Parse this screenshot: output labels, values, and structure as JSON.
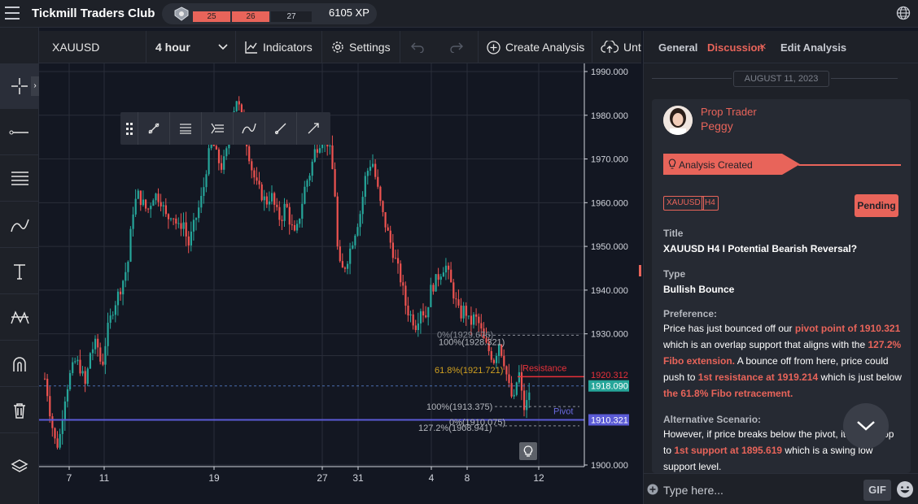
{
  "app": {
    "title": "Tickmill Traders Club"
  },
  "xp": {
    "seg1": "25",
    "seg2": "26",
    "seg3": "27",
    "value": "6105 XP"
  },
  "toolbar": {
    "symbol": "XAUUSD",
    "timeframe": "4 hour",
    "indicators": "Indicators",
    "settings": "Settings",
    "create_analysis": "Create Analysis",
    "upload": "Unt"
  },
  "chart": {
    "prices": [
      "1990.000",
      "1980.000",
      "1970.000",
      "1960.000",
      "1950.000",
      "1940.000",
      "1930.000",
      "1918.090",
      "1910.321",
      "1900.000"
    ],
    "price_under": "1920.312",
    "dates": [
      "7",
      "11",
      "19",
      "27",
      "31",
      "4",
      "8",
      "12"
    ],
    "fib_labels": {
      "top": "0%(1929.676)",
      "top2": "100%(1928.321)",
      "mid": "61.8%(1921.721)",
      "resistance": "Resistance",
      "p100": "100%(1913.375)",
      "pivot": "Pivot",
      "p0": "0%(1910.075)",
      "p127": "127.2%(1908.941)"
    },
    "colors": {
      "up": "#26a69a",
      "down": "#ef5350",
      "pivot": "#5b5bd6",
      "resistance": "#e8313a"
    }
  },
  "panel": {
    "tabs": [
      "General",
      "Discussion",
      "Edit Analysis"
    ],
    "tab_close": "×",
    "date": "AUGUST 11, 2023",
    "author_role": "Prop Trader",
    "author_name": "Peggy",
    "event": "Analysis Created",
    "tags": [
      "XAUUSD",
      "H4"
    ],
    "status": "Pending",
    "title_label": "Title",
    "title_value": "XAUUSD H4 I Potential Bearish Reversal?",
    "type_label": "Type",
    "type_value": "Bullish Bounce",
    "pref_label": "Preference:",
    "pref": {
      "t1": "Price has just bounced off our ",
      "h1": "pivot point of 1910.321",
      "t2": " which is an overlap support that aligns with the ",
      "h2": "127.2% Fibo extension.",
      "t3": " A bounce off from here, price could push to ",
      "h3": "1st resistance at 1919.214",
      "t4": " which is just below ",
      "h4": "the 61.8% Fibo retracement."
    },
    "alt_label": "Alternative Scenario:",
    "alt": {
      "t1": "However, if price breaks below the pivot, it could drop to ",
      "h1": "1st support at 1895.619",
      "t2": " which is a swing low support level."
    },
    "composer_placeholder": "Type here...",
    "gif": "GIF"
  }
}
